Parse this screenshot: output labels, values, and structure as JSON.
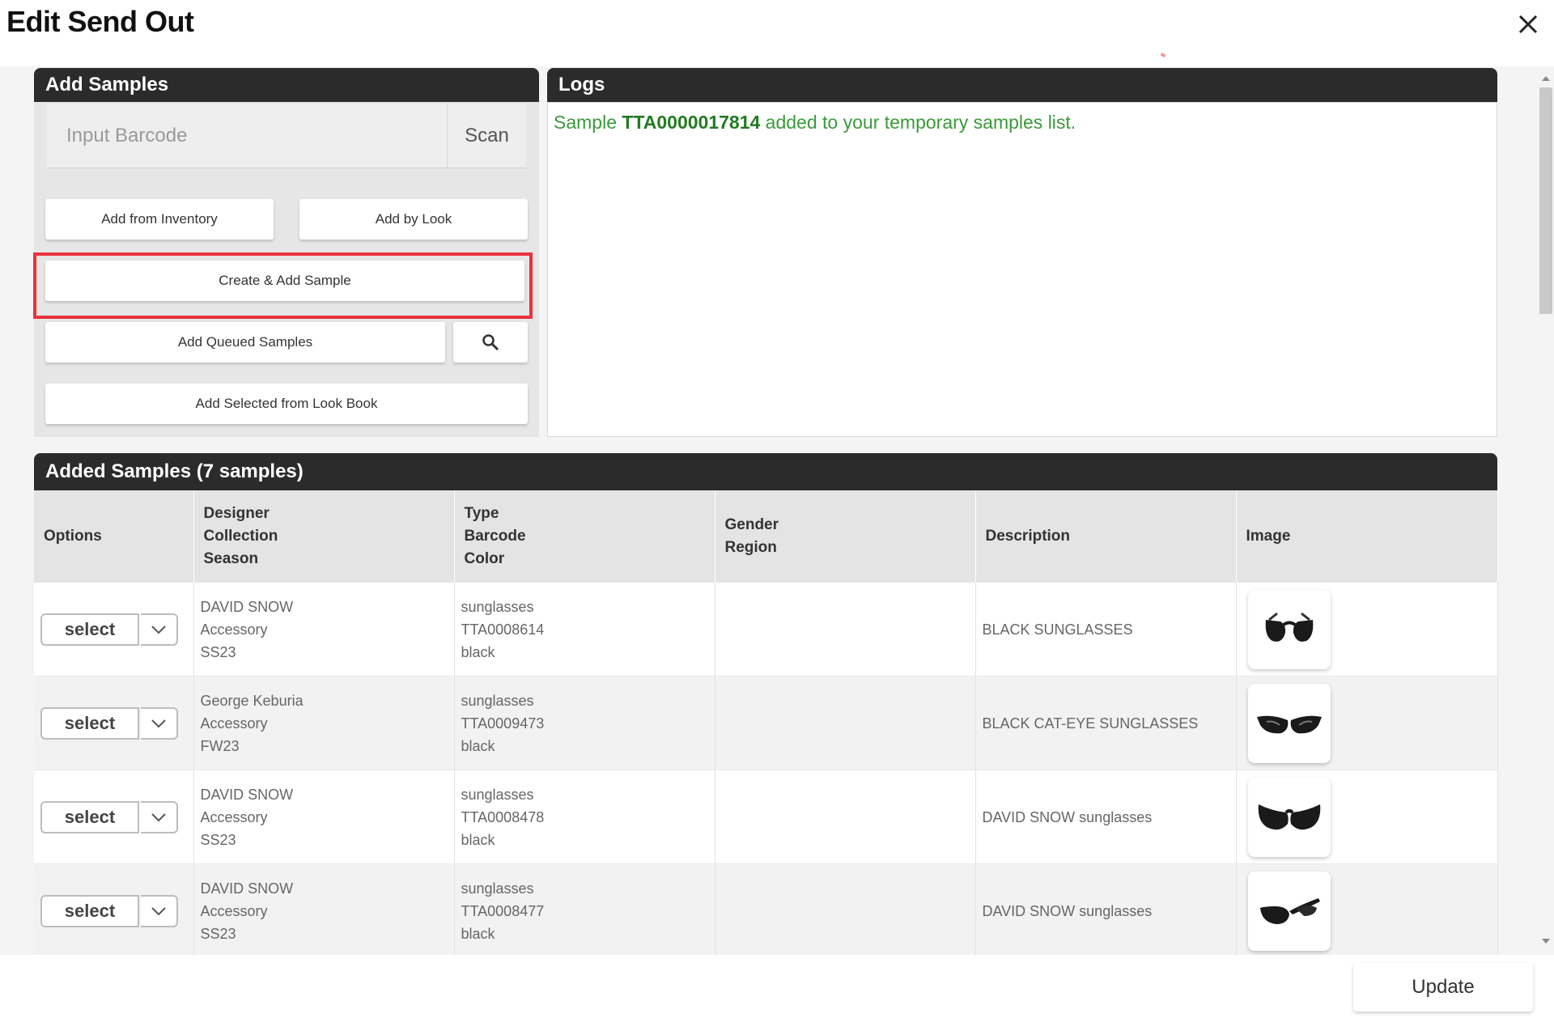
{
  "dialog": {
    "title": "Edit Send Out"
  },
  "add_samples": {
    "header": "Add Samples",
    "barcode_placeholder": "Input Barcode",
    "scan_label": "Scan",
    "add_from_inventory": "Add from Inventory",
    "add_by_look": "Add by Look",
    "create_add_sample": "Create & Add Sample",
    "add_queued_samples": "Add Queued Samples",
    "add_selected_lookbook": "Add Selected from Look Book"
  },
  "logs": {
    "header": "Logs",
    "entry": {
      "prefix": "Sample ",
      "id": "TTA0000017814",
      "suffix": " added to your temporary samples list."
    }
  },
  "added_samples": {
    "header": "Added Samples (7 samples)",
    "columns": {
      "options": "Options",
      "designer": [
        "Designer",
        "Collection",
        "Season"
      ],
      "type": [
        "Type",
        "Barcode",
        "Color"
      ],
      "gender": [
        "Gender",
        "Region"
      ],
      "description": "Description",
      "image": "Image"
    },
    "select_label": "select",
    "rows": [
      {
        "designer": "DAVID SNOW",
        "collection": "Accessory",
        "season": "SS23",
        "type": "sunglasses",
        "barcode": "TTA0008614",
        "color": "black",
        "gender": "",
        "region": "",
        "description": "BLACK SUNGLASSES",
        "image_icon": "sunglasses-front-icon"
      },
      {
        "designer": "George Keburia",
        "collection": "Accessory",
        "season": "FW23",
        "type": "sunglasses",
        "barcode": "TTA0009473",
        "color": "black",
        "gender": "",
        "region": "",
        "description": "BLACK CAT-EYE SUNGLASSES",
        "image_icon": "cat-eye-sunglasses-icon"
      },
      {
        "designer": "DAVID SNOW",
        "collection": "Accessory",
        "season": "SS23",
        "type": "sunglasses",
        "barcode": "TTA0008478",
        "color": "black",
        "gender": "",
        "region": "",
        "description": "DAVID SNOW sunglasses",
        "image_icon": "wrap-sunglasses-icon"
      },
      {
        "designer": "DAVID SNOW",
        "collection": "Accessory",
        "season": "SS23",
        "type": "sunglasses",
        "barcode": "TTA0008477",
        "color": "black",
        "gender": "",
        "region": "",
        "description": "DAVID SNOW sunglasses",
        "image_icon": "side-sunglasses-icon"
      }
    ]
  },
  "footer": {
    "update_label": "Update"
  },
  "colors": {
    "header_bg": "#2b2b2b",
    "log_text": "#3a9a3a",
    "highlight": "#e8323c"
  }
}
